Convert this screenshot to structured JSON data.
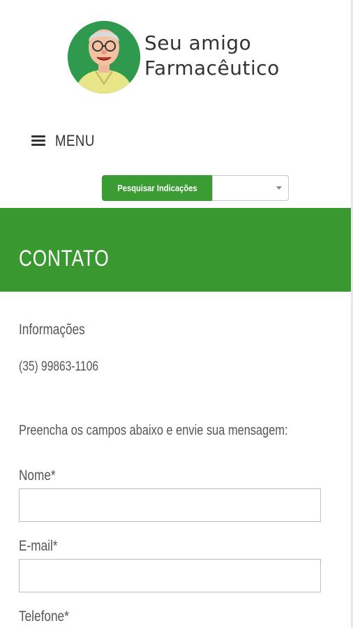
{
  "header": {
    "logo_line1": "Seu amigo",
    "logo_line2": "Farmacêutico"
  },
  "nav": {
    "menu_label": "MENU"
  },
  "search": {
    "button_label": "Pesquisar Indicações",
    "select_value": ""
  },
  "page": {
    "title": "CONTATO"
  },
  "info": {
    "heading": "Informações",
    "phone": "(35) 99863-1106"
  },
  "form": {
    "intro": "Preencha os campos abaixo e envie sua mensagem:",
    "name_label": "Nome*",
    "name_value": "",
    "email_label": "E-mail*",
    "email_value": "",
    "phone_label": "Telefone*"
  },
  "colors": {
    "brand_green": "#3a9830",
    "button_green": "#3a9c33",
    "text_gray": "#555555"
  },
  "icons": {
    "menu": "hamburger-icon",
    "select": "chevron-down-icon",
    "logo": "pharmacist-avatar-logo"
  }
}
